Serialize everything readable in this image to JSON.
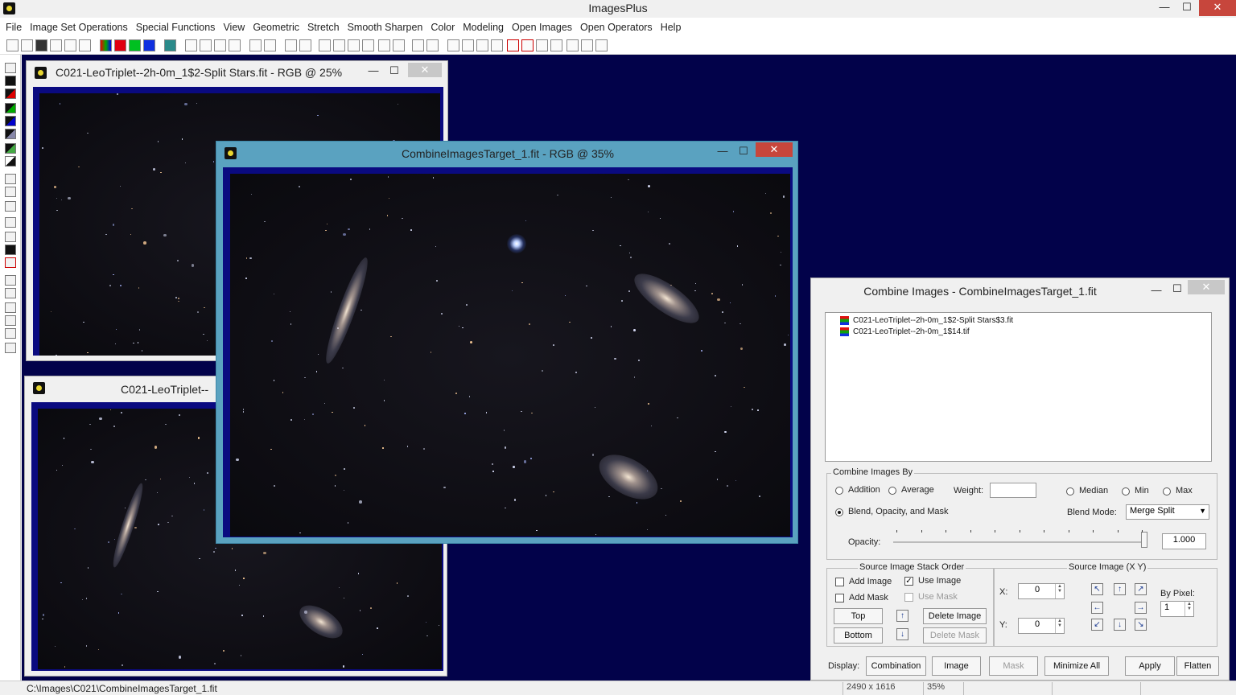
{
  "app": {
    "title": "ImagesPlus"
  },
  "menu": [
    "File",
    "Image Set Operations",
    "Special Functions",
    "View",
    "Geometric",
    "Stretch",
    "Smooth Sharpen",
    "Color",
    "Modeling",
    "Open Images",
    "Open Operators",
    "Help"
  ],
  "window_controls": {
    "minimize": "—",
    "maximize": "☐",
    "close": "✕"
  },
  "windows": {
    "stars": {
      "title": "C021-LeoTriplet--2h-0m_1$2-Split Stars.fit - RGB @ 25%"
    },
    "leo": {
      "title": "C021-LeoTriplet--"
    },
    "target": {
      "title": "CombineImagesTarget_1.fit - RGB @ 35%"
    }
  },
  "dialog": {
    "title": "Combine Images - CombineImagesTarget_1.fit",
    "files": [
      "C021-LeoTriplet--2h-0m_1$2-Split Stars$3.fit",
      "C021-LeoTriplet--2h-0m_1$14.tif"
    ],
    "combine_by": {
      "group_label": "Combine Images By",
      "addition": "Addition",
      "average": "Average",
      "weight_label": "Weight:",
      "weight_value": "",
      "median": "Median",
      "min": "Min",
      "max": "Max",
      "blend": "Blend, Opacity, and Mask",
      "blend_selected": true,
      "blend_mode_label": "Blend Mode:",
      "blend_mode_value": "Merge Split",
      "opacity_label": "Opacity:",
      "opacity_value": "1.000",
      "opacity_fraction": 1.0
    },
    "stack_order": {
      "group_label": "Source Image Stack Order",
      "add_image": "Add Image",
      "use_image": "Use Image",
      "use_image_checked": true,
      "add_mask": "Add Mask",
      "use_mask": "Use Mask",
      "top": "Top",
      "bottom": "Bottom",
      "delete_image": "Delete Image",
      "delete_mask": "Delete Mask",
      "up_arrow": "↑",
      "down_arrow": "↓"
    },
    "source_xy": {
      "group_label": "Source Image (X Y)",
      "x_label": "X:",
      "x_value": "0",
      "y_label": "Y:",
      "y_value": "0",
      "by_pixel_label": "By Pixel:",
      "by_pixel_value": "1",
      "arrows": [
        "↖",
        "↑",
        "↗",
        "←",
        "→",
        "↙",
        "↓",
        "↘"
      ]
    },
    "display": {
      "label": "Display:",
      "combination": "Combination",
      "image": "Image",
      "mask": "Mask",
      "minimize_all": "Minimize All",
      "apply": "Apply",
      "flatten": "Flatten"
    }
  },
  "status": {
    "path": "C:\\Images\\C021\\CombineImagesTarget_1.fit",
    "dimensions": "2490 x 1616",
    "zoom": "35%"
  },
  "icon_names": [
    "app-icon",
    "window-icon",
    "new-icon",
    "open-icon",
    "save-icon",
    "close-image-icon",
    "undo-icon",
    "redo-icon",
    "zoom-in-icon",
    "zoom-out-icon"
  ]
}
